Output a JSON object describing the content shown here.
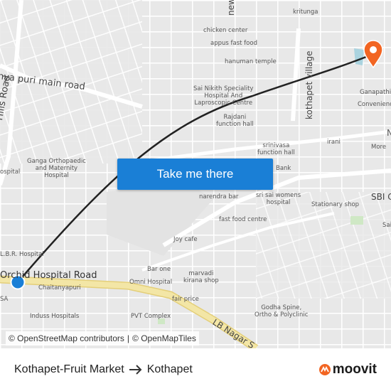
{
  "map": {
    "labels": {
      "chicken_center": "chicken center",
      "appus_fast_food": "appus fast food",
      "kritunga": "kritunga",
      "hanuman_temple": "hanuman temple",
      "sai_nikith": "Sai Nikith Speciality\nHospital And\nLaproscopic Centre",
      "rajdani": "Rajdani\nfunction hall",
      "srinivasa": "srinivasa\nfunction hall",
      "irani": "irani",
      "more": "More",
      "ganapathi": "Ganapathi",
      "convenience": "Convenienc",
      "ganga": "Ganga Orthopaedic\nand Maternity\nHospital",
      "hospital_left": "ospital",
      "bank": "Bank",
      "narendra_bar": "narendra bar",
      "sri_sai": "sri sai womens\nhospital",
      "stationary": "Stationary shop",
      "fast_food_centre": "fast food centre",
      "joy_cafe": "Joy cafe",
      "bar_one": "Bar one",
      "marvadi": "marvadi\nkirana shop",
      "omni": "Omni Hospital",
      "fair_price": "fair price",
      "chaitanyapuri": "Chaitanyapuri",
      "lbr_hospital": "L.B.R. Hospital",
      "sa": "SA",
      "induss": "Induss Hospitals",
      "pvt_complex": "PVT Complex",
      "godha": "Godha Spine,\nOrtho & Polyclinic",
      "sai_right": "Sai",
      "n_right": "N"
    },
    "roads": {
      "puri_main": "nya puri main road",
      "hills_road": "Hills Road",
      "kothapet_village": "kothapet village",
      "new_top": "new",
      "orchid": "Orchid Hospital Road",
      "lb_nagar": "LB Nagar S",
      "sbi": "SBI C"
    },
    "colors": {
      "route": "#222222",
      "origin": "#1a7fd6",
      "destination": "#f26522",
      "major_road": "#f3e6a6"
    },
    "icons": {
      "origin": "origin-dot-icon",
      "destination": "destination-pin-icon"
    }
  },
  "cta": {
    "label": "Take me there"
  },
  "attribution": {
    "osm": "© OpenStreetMap contributors",
    "omt": "© OpenMapTiles",
    "separator": "|"
  },
  "route": {
    "from": "Kothapet-Fruit Market",
    "to": "Kothapet"
  },
  "brand": {
    "name": "moovit"
  }
}
